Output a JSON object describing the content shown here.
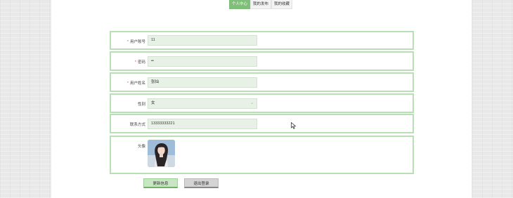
{
  "tabs": [
    {
      "label": "个人中心",
      "active": true
    },
    {
      "label": "我的发布",
      "active": false
    },
    {
      "label": "我的收藏",
      "active": false
    }
  ],
  "form": {
    "username": {
      "label": "用户账号",
      "required": "*",
      "value": "11"
    },
    "password": {
      "label": "密码",
      "required": "*",
      "value": "••"
    },
    "realname": {
      "label": "用户姓名",
      "required": "*",
      "value": "张灿"
    },
    "gender": {
      "label": "性别",
      "value": "女",
      "icon": "chevron-down-icon"
    },
    "phone": {
      "label": "联系方式",
      "value": "13333333221"
    },
    "avatar": {
      "label": "头像"
    }
  },
  "buttons": {
    "update_label": "更新信息",
    "logout_label": "退出登录"
  },
  "colors": {
    "accent": "#7fbf7a",
    "row_border": "#b9e0b4",
    "field_bg": "#e8f1e6",
    "required": "#d9534f"
  }
}
